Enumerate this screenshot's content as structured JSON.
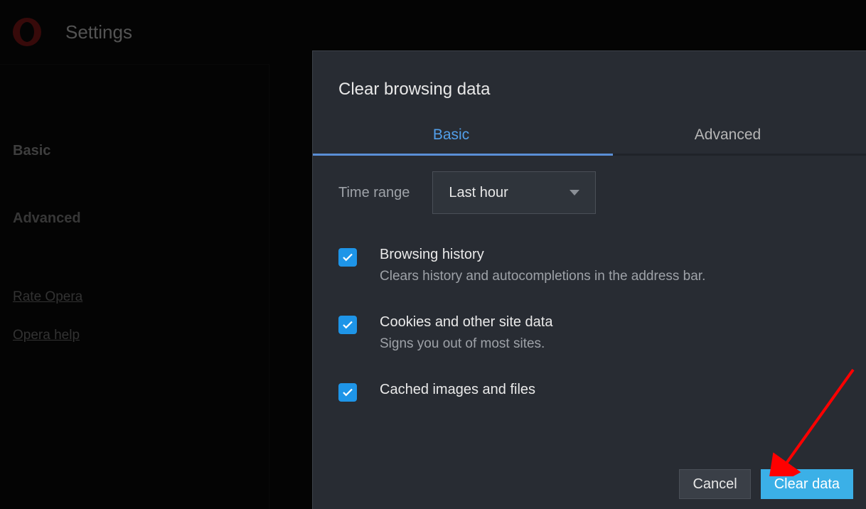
{
  "header": {
    "title": "Settings"
  },
  "sidebar": {
    "nav": {
      "basic": "Basic",
      "advanced": "Advanced"
    },
    "links": {
      "rate": "Rate Opera",
      "help": "Opera help"
    }
  },
  "dialog": {
    "title": "Clear browsing data",
    "tabs": {
      "basic": "Basic",
      "advanced": "Advanced"
    },
    "time_range_label": "Time range",
    "time_range_value": "Last hour",
    "options": [
      {
        "title": "Browsing history",
        "desc": "Clears history and autocompletions in the address bar.",
        "checked": true
      },
      {
        "title": "Cookies and other site data",
        "desc": "Signs you out of most sites.",
        "checked": true
      },
      {
        "title": "Cached images and files",
        "desc": "",
        "checked": true
      }
    ],
    "buttons": {
      "cancel": "Cancel",
      "clear": "Clear data"
    }
  }
}
